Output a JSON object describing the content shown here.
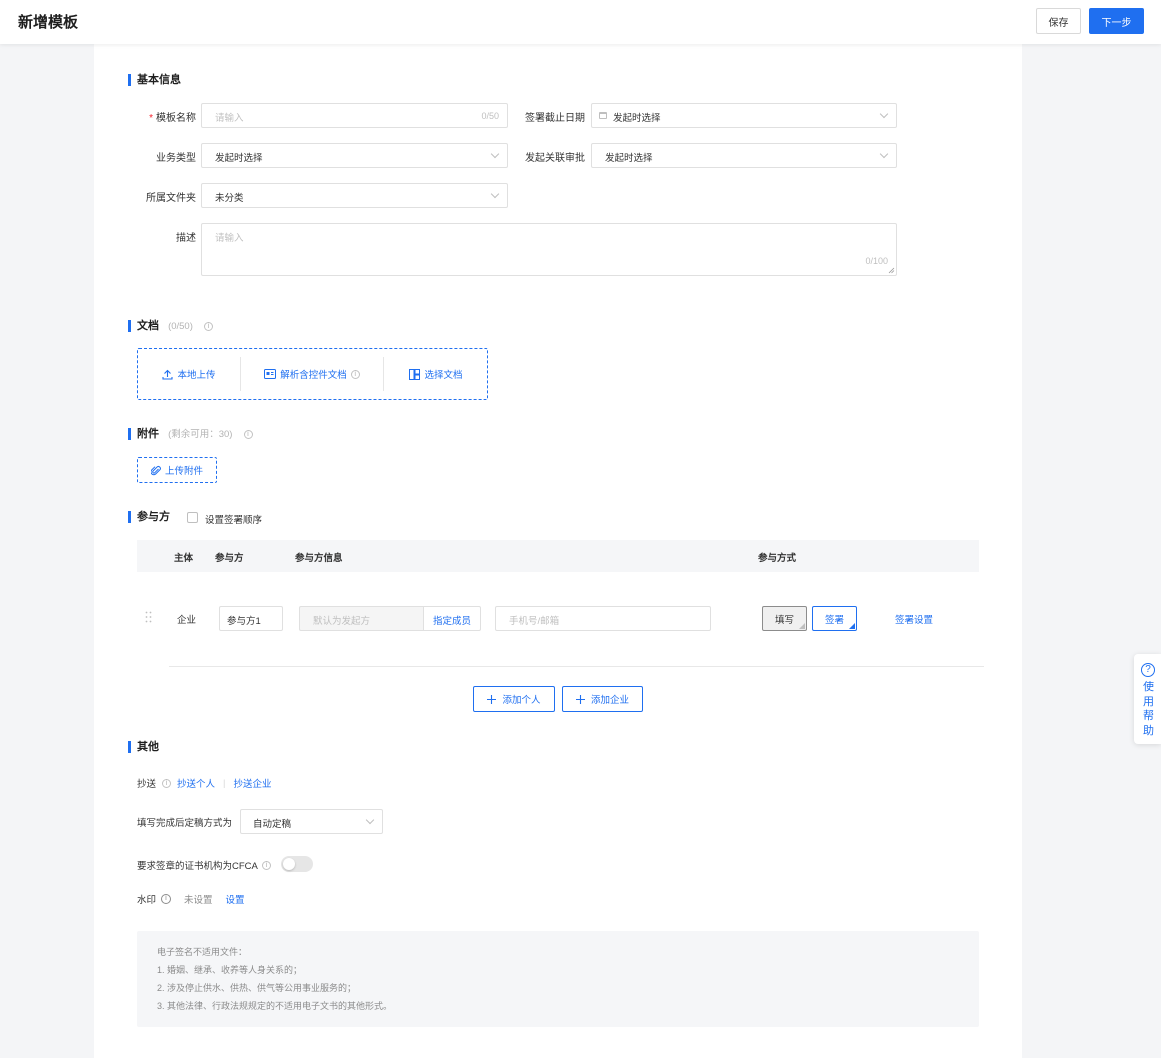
{
  "header": {
    "title": "新增模板",
    "save_label": "保存",
    "next_label": "下一步"
  },
  "basic": {
    "title": "基本信息",
    "name_label": "模板名称",
    "name_placeholder": "请输入",
    "name_count": "0/50",
    "deadline_label": "签署截止日期",
    "deadline_value": "发起时选择",
    "biz_label": "业务类型",
    "biz_value": "发起时选择",
    "approval_label": "发起关联审批",
    "approval_value": "发起时选择",
    "folder_label": "所属文件夹",
    "folder_value": "未分类",
    "desc_label": "描述",
    "desc_placeholder": "请输入",
    "desc_count": "0/100"
  },
  "docs": {
    "title": "文档",
    "count": "(0/50)",
    "local_upload": "本地上传",
    "parse_doc": "解析含控件文档",
    "choose_doc": "选择文档"
  },
  "attachments": {
    "title": "附件",
    "remaining": "(剩余可用：30)",
    "upload_label": "上传附件"
  },
  "participants": {
    "title": "参与方",
    "order_label": "设置签署顺序",
    "headers": {
      "subject": "主体",
      "party": "参与方",
      "info": "参与方信息",
      "mode": "参与方式"
    },
    "row": {
      "subject": "企业",
      "party_name": "参与方1",
      "initiator_placeholder": "默认为发起方",
      "assign_label": "指定成员",
      "contact_placeholder": "手机号/邮箱",
      "fill_label": "填写",
      "sign_label": "签署",
      "settings_label": "签署设置"
    },
    "add_person": "添加个人",
    "add_company": "添加企业"
  },
  "other": {
    "title": "其他",
    "cc_label": "抄送",
    "cc_person": "抄送个人",
    "cc_sep": "|",
    "cc_company": "抄送企业",
    "finalize_label": "填写完成后定稿方式为",
    "finalize_value": "自动定稿",
    "cfca_label": "要求签章的证书机构为CFCA",
    "watermark_label": "水印",
    "watermark_status": "未设置",
    "watermark_setting": "设置"
  },
  "notice": {
    "title": "电子签名不适用文件：",
    "items": [
      "1. 婚姻、继承、收养等人身关系的；",
      "2. 涉及停止供水、供热、供气等公用事业服务的；",
      "3. 其他法律、行政法规规定的不适用电子文书的其他形式。"
    ]
  },
  "help": {
    "label": "使用帮助",
    "icon": "?"
  },
  "colors": {
    "primary": "#1f6ff0",
    "required": "#f5222d"
  }
}
